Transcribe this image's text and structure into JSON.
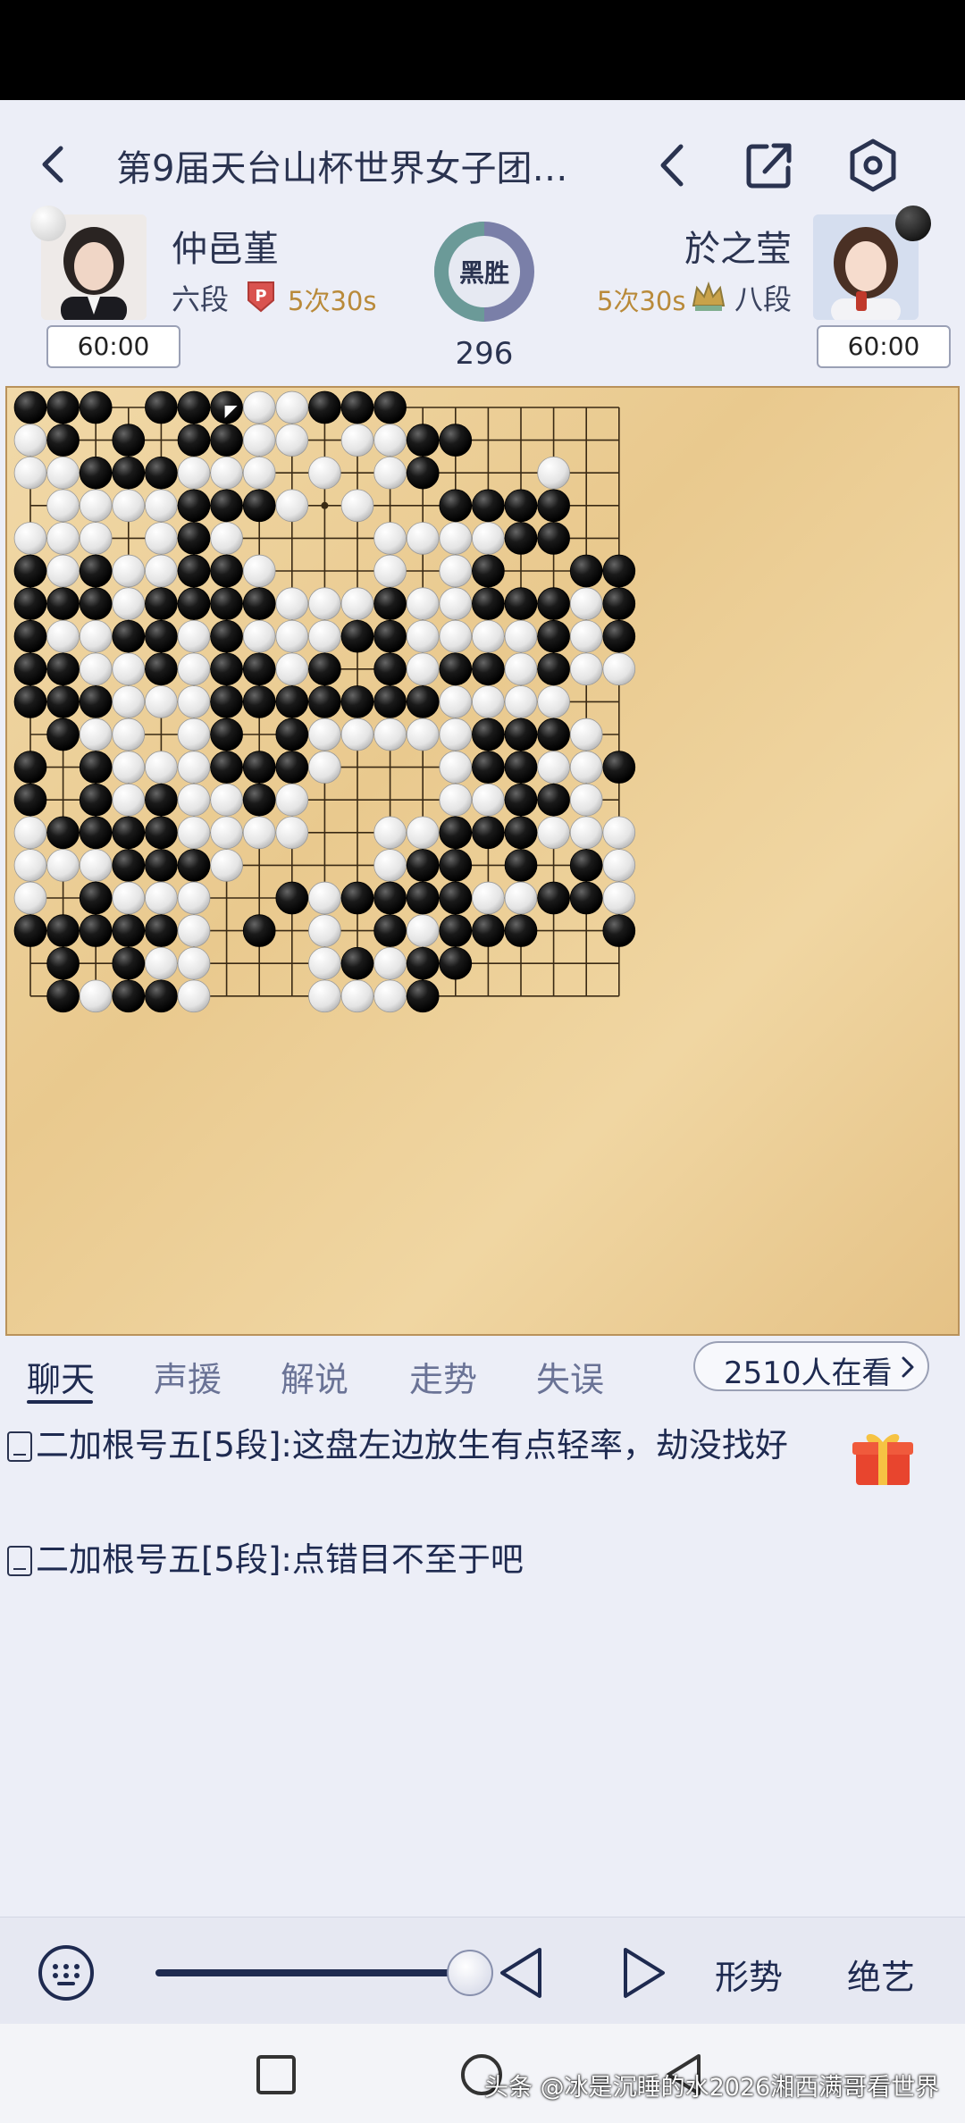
{
  "header": {
    "title": "第9届天台山杯世界女子团…",
    "back_icon": "chevron-left-icon",
    "prev_icon": "chevron-left-icon",
    "share_icon": "share-icon",
    "settings_icon": "hexagon-settings-icon"
  },
  "players": {
    "white": {
      "name": "仲邑堇",
      "rank": "六段",
      "byoyomi": "5次30s",
      "clock": "60:00",
      "badge": "P-badge-icon"
    },
    "black": {
      "name": "於之莹",
      "rank": "八段",
      "byoyomi": "5次30s",
      "clock": "60:00",
      "badge": "crown-badge-icon"
    }
  },
  "result": {
    "label": "黑胜",
    "move_count": "296"
  },
  "board": {
    "size": 19,
    "rows": [
      "BBB.BBBWWBBB.......",
      "WB.B.BBWW.WWBB.....",
      "WWBBBWWW.W.WB...W..",
      ".WWWWBBBW.W..BBBB..",
      "WWW.WBW....WWWWBB..",
      "BWBWWBBW...W.WB..BB",
      "BBBWBBBBWWWBWWBBBWB",
      "BWWBBWBWWWBBWWWWBWB",
      "BBWWBWBBWB.BWBBWBWW",
      "BBBWWWBBBBBBBWWWW..",
      ".BWW.WB.BWWWWWBBBW.",
      "B.BWWWBBBW...WBBWWBW",
      "B.BWBWWBW....WWBBW..",
      "WBBBBWWWW..WWBBBWWW.",
      "WWWBBBW....WBB.B.BW.",
      "W.BWWW..BWBBBBWWBBW",
      "BBBBBW.B.W.BWBBB..B",
      ".B.BWW...WBWBB.....",
      ".BWBBW...WWWB......"
    ],
    "last_move": {
      "row": 0,
      "col": 6
    },
    "hoshi_marked": {
      "row": 3,
      "col": 9
    }
  },
  "tabs": [
    "聊天",
    "声援",
    "解说",
    "走势",
    "失误"
  ],
  "viewers": "2510人在看",
  "chat": [
    "二加根号五[5段]:这盘左边放生有点轻率，劫没找好",
    "二加根号五[5段]:点错目不至于吧"
  ],
  "bottom": {
    "keyboard_icon": "keyboard-icon",
    "replay_position": 0.93,
    "prev_icon": "triangle-left-icon",
    "next_icon": "triangle-right-icon",
    "situation_label": "形势",
    "tesuji_label": "绝艺"
  },
  "watermark": "头条 @冰是沉睡的水2026湘西满哥看世界",
  "colors": {
    "background": "#eceef7",
    "accent": "#1e2a50",
    "board": "#ecd09a",
    "byoyomi": "#b98a3a",
    "gift": "#e8452e"
  }
}
